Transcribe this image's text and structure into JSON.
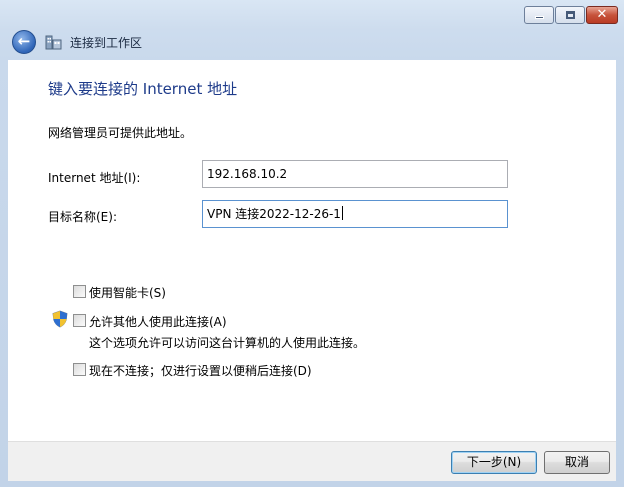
{
  "window": {
    "title": "连接到工作区",
    "controls": {
      "minimize": "minimize-icon",
      "maximize": "maximize-icon",
      "close": "close-icon",
      "back": "back-arrow-icon"
    }
  },
  "page": {
    "heading": "键入要连接的 Internet 地址",
    "description": "网络管理员可提供此地址。"
  },
  "form": {
    "address_label": "Internet 地址(I):",
    "address_value": "192.168.10.2",
    "dest_label": "目标名称(E):",
    "dest_value": "VPN 连接2022-12-26-1"
  },
  "options": {
    "smartcard": {
      "label": "使用智能卡(S)",
      "checked": false
    },
    "allow_others": {
      "label": "允许其他人使用此连接(A)",
      "checked": false,
      "note": "这个选项允许可以访问这台计算机的人使用此连接。",
      "icon": "uac-shield-icon"
    },
    "dont_connect": {
      "label": "现在不连接；仅进行设置以便稍后连接(D)",
      "checked": false
    }
  },
  "buttons": {
    "next": "下一步(N)",
    "cancel": "取消"
  }
}
